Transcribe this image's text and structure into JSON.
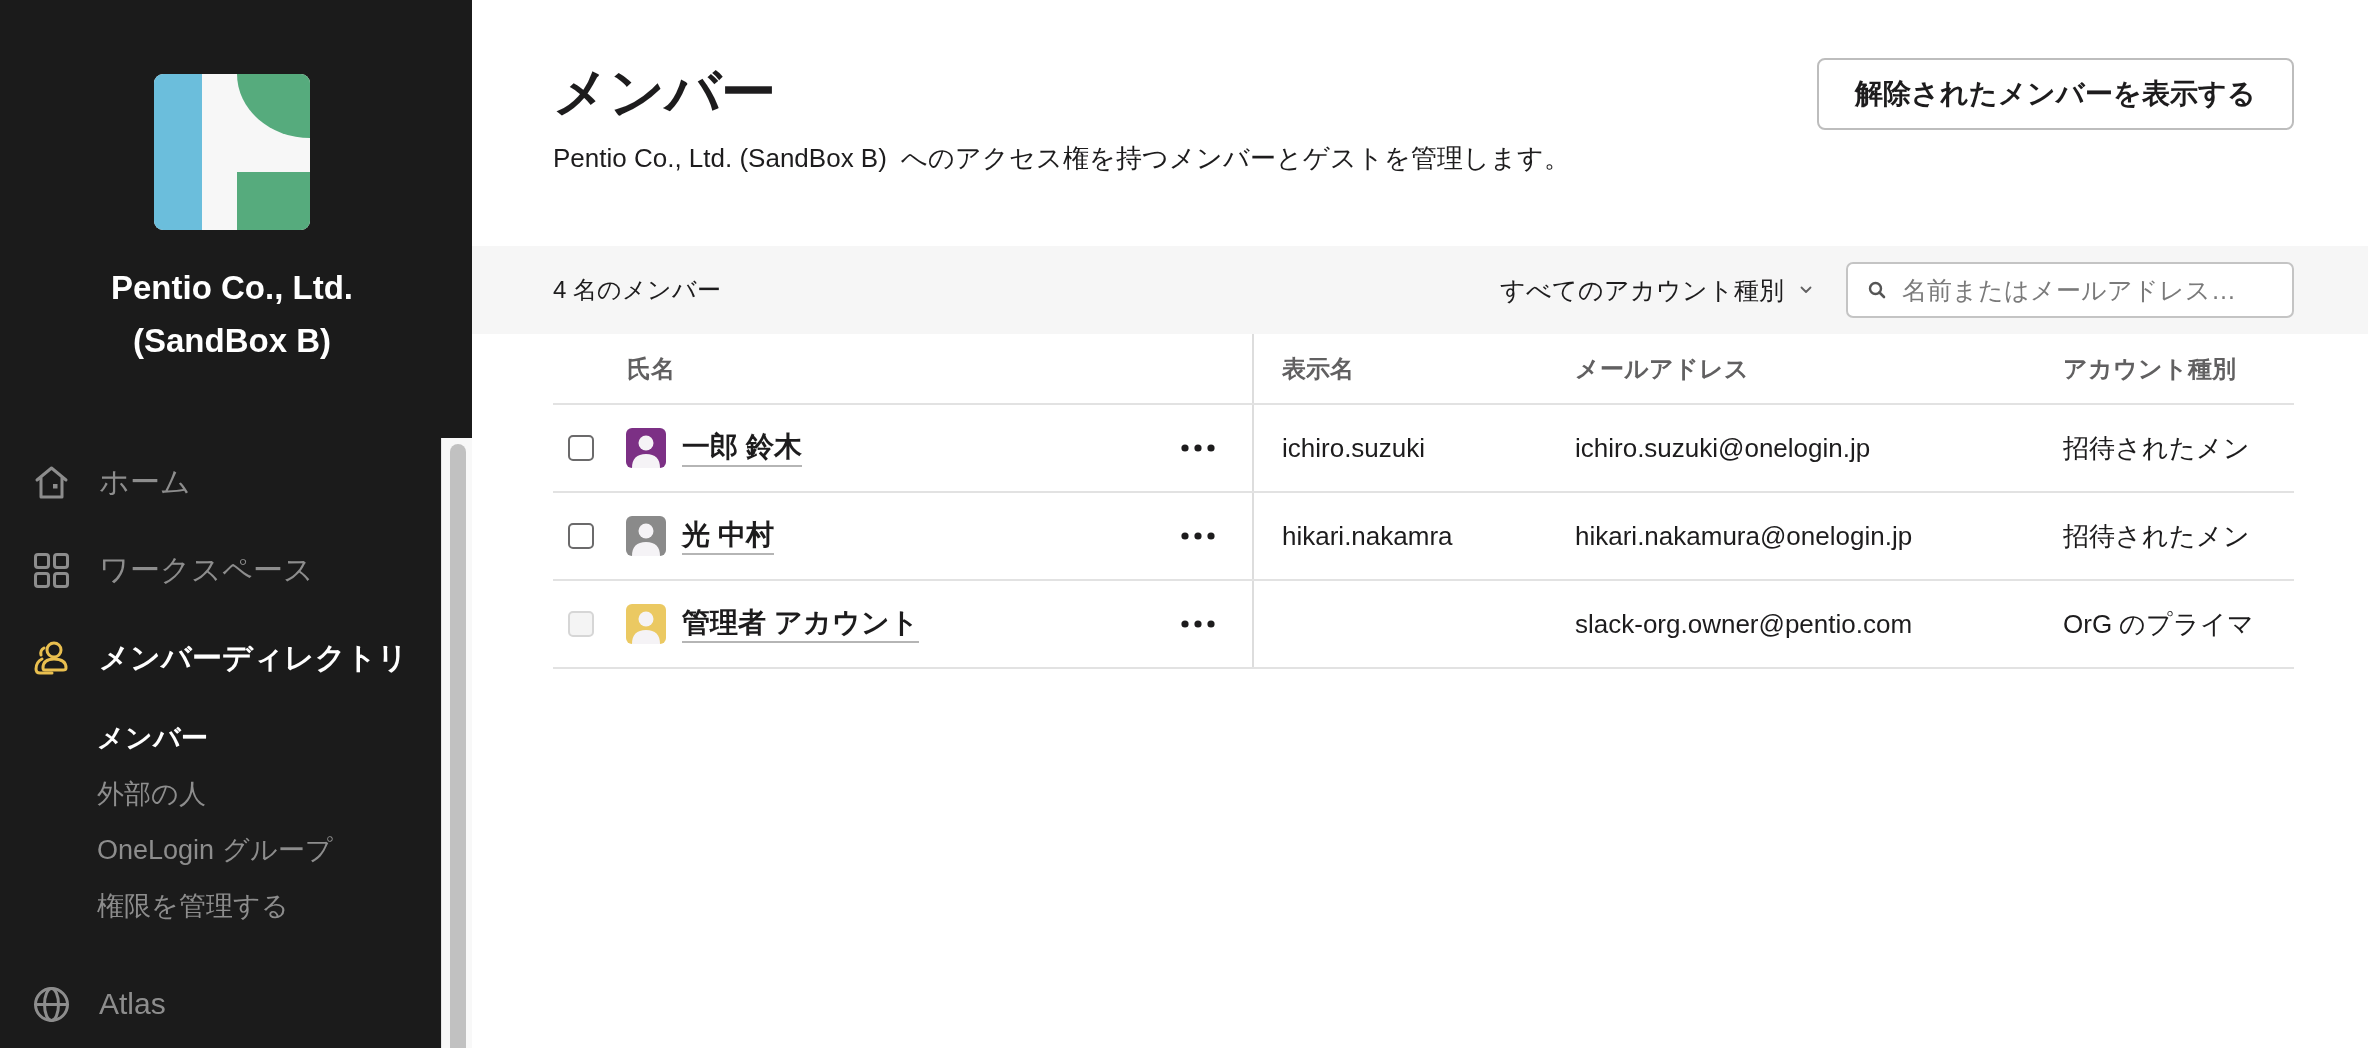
{
  "sidebar": {
    "org_name": "Pentio Co., Ltd. (SandBox B)",
    "nav": [
      {
        "label": "ホーム",
        "selected": false
      },
      {
        "label": "ワークスペース",
        "selected": false
      },
      {
        "label": "メンバーディレクトリ",
        "selected": true,
        "children": [
          {
            "label": "メンバー",
            "selected": true
          },
          {
            "label": "外部の人",
            "selected": false
          },
          {
            "label": "OneLogin グループ",
            "selected": false
          },
          {
            "label": "権限を管理する",
            "selected": false
          }
        ]
      },
      {
        "label": "Atlas",
        "selected": false
      }
    ]
  },
  "header": {
    "title": "メンバー",
    "description": "Pentio Co., Ltd. (SandBox B)  へのアクセス権を持つメンバーとゲストを管理します。",
    "button": "解除されたメンバーを表示する"
  },
  "toolbar": {
    "member_count": "4 名のメンバー",
    "account_filter": "すべてのアカウント種別",
    "search": {
      "placeholder": "名前またはメールアドレス…"
    }
  },
  "table": {
    "columns": [
      "氏名",
      "表示名",
      "メールアドレス",
      "アカウント種別"
    ],
    "rows": [
      {
        "checked": false,
        "disabled": false,
        "color": "#7c3085",
        "name": "一郎 鈴木",
        "display_name": "ichiro.suzuki",
        "email": "ichiro.suzuki@onelogin.jp",
        "account_type": "招待されたメン"
      },
      {
        "checked": false,
        "disabled": false,
        "color": "#8a8a8a",
        "name": "光 中村",
        "display_name": "hikari.nakamra",
        "email": "hikari.nakamura@onelogin.jp",
        "account_type": "招待されたメン"
      },
      {
        "checked": false,
        "disabled": true,
        "color": "#ebc962",
        "name": "管理者 アカウント",
        "email": "slack-org.owner@pentio.com",
        "account_type": "OrG のプライマ"
      }
    ]
  }
}
